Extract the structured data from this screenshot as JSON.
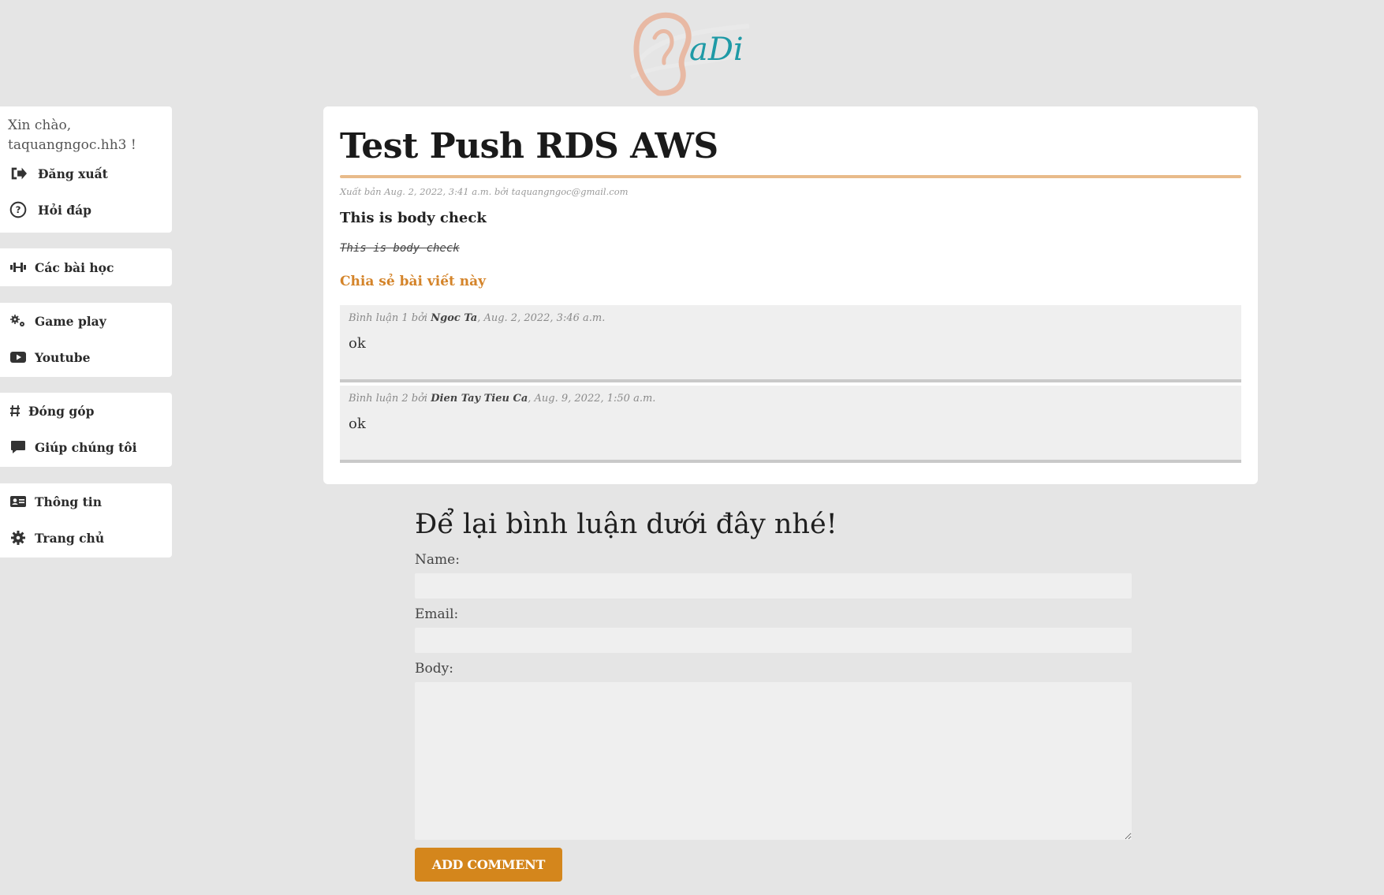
{
  "logo": {
    "text": "aDi",
    "colors": {
      "ear": "#e8b9a4",
      "text": "#1f9aa6"
    }
  },
  "sidebar": {
    "greeting": "Xin chào, taquangngoc.hh3 !",
    "account": [
      {
        "label": "Đăng xuất",
        "icon": "logout-icon"
      },
      {
        "label": "Hỏi đáp",
        "icon": "question-icon"
      }
    ],
    "lessons": [
      {
        "label": "Các bài học",
        "icon": "dumbbell-icon"
      }
    ],
    "media": [
      {
        "label": "Game play",
        "icon": "gears-icon"
      },
      {
        "label": "Youtube",
        "icon": "youtube-icon"
      }
    ],
    "community": [
      {
        "label": "Đóng góp",
        "icon": "hashtag-icon"
      },
      {
        "label": "Giúp chúng tôi",
        "icon": "comment-icon"
      }
    ],
    "info": [
      {
        "label": "Thông tin",
        "icon": "id-card-icon"
      },
      {
        "label": "Trang chủ",
        "icon": "gear-icon"
      }
    ]
  },
  "post": {
    "title": "Test Push RDS AWS",
    "meta": "Xuất bản Aug. 2, 2022, 3:41 a.m. bởi taquangngoc@gmail.com",
    "body": "This is body check",
    "code": "This is body check",
    "share_label": "Chia sẻ bài viết này",
    "accent_color": "#e8bb8a"
  },
  "comments": [
    {
      "prefix": "Bình luận 1 bởi",
      "author": "Ngoc Ta",
      "date": ", Aug. 2, 2022, 3:46 a.m.",
      "text": "ok"
    },
    {
      "prefix": "Bình luận 2 bởi",
      "author": "Dien Tay Tieu Ca",
      "date": ", Aug. 9, 2022, 1:50 a.m.",
      "text": "ok"
    }
  ],
  "form": {
    "heading": "Để lại bình luận dưới đây nhé!",
    "name_label": "Name:",
    "email_label": "Email:",
    "body_label": "Body:",
    "name_value": "",
    "email_value": "",
    "body_value": "",
    "submit_label": "ADD COMMENT",
    "button_color": "#d4861c"
  }
}
